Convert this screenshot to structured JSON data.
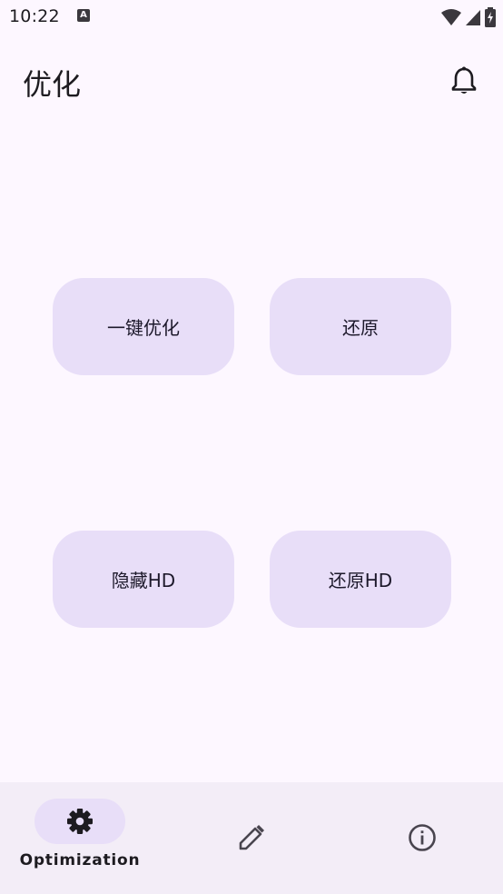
{
  "status_bar": {
    "time": "10:22",
    "notification_glyph": "A",
    "icons": [
      "wifi-icon",
      "cell-signal-icon",
      "battery-charging-icon"
    ]
  },
  "app_bar": {
    "title": "优化",
    "action_icon": "bell-icon"
  },
  "buttons": {
    "one_click_optimize": "一键优化",
    "restore": "还原",
    "hide_hd": "隐藏HD",
    "restore_hd": "还原HD"
  },
  "bottom_nav": {
    "items": [
      {
        "label": "Optimization",
        "icon": "gear-icon",
        "selected": true
      },
      {
        "label": "",
        "icon": "pencil-icon",
        "selected": false
      },
      {
        "label": "",
        "icon": "info-icon",
        "selected": false
      }
    ]
  },
  "colors": {
    "background": "#fdf7ff",
    "button_container": "#e8def8",
    "nav_background": "#f3edf7",
    "on_surface": "#1d1b20"
  }
}
